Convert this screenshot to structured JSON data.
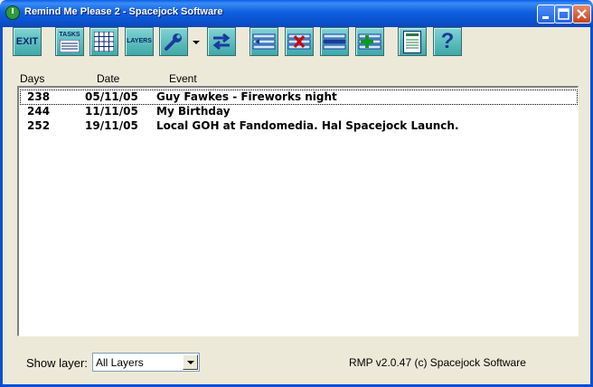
{
  "window": {
    "title": "Remind Me Please 2 - Spacejock Software"
  },
  "toolbar": {
    "exit_label": "EXIT",
    "tasks_label": "TASKS",
    "layers_label": "LAYERS",
    "help_label": "?"
  },
  "list": {
    "columns": {
      "days": "Days",
      "date": "Date",
      "event": "Event"
    },
    "rows": [
      {
        "days": "238",
        "date": "05/11/05",
        "event": "Guy Fawkes - Fireworks night"
      },
      {
        "days": "244",
        "date": "11/11/05",
        "event": "My Birthday"
      },
      {
        "days": "252",
        "date": "19/11/05",
        "event": "Local GOH at Fandomedia. Hal Spacejock Launch."
      }
    ]
  },
  "footer": {
    "show_layer_label": "Show layer:",
    "layer_value": "All Layers",
    "version": "RMP v2.0.47 (c) Spacejock Software"
  }
}
